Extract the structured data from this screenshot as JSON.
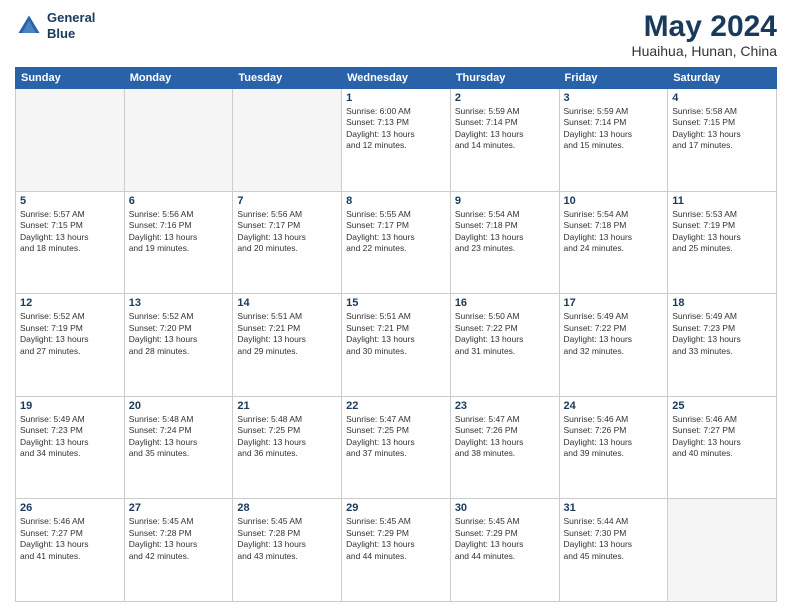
{
  "header": {
    "logo_line1": "General",
    "logo_line2": "Blue",
    "title": "May 2024",
    "subtitle": "Huaihua, Hunan, China"
  },
  "weekdays": [
    "Sunday",
    "Monday",
    "Tuesday",
    "Wednesday",
    "Thursday",
    "Friday",
    "Saturday"
  ],
  "weeks": [
    [
      {
        "day": "",
        "info": ""
      },
      {
        "day": "",
        "info": ""
      },
      {
        "day": "",
        "info": ""
      },
      {
        "day": "1",
        "info": "Sunrise: 6:00 AM\nSunset: 7:13 PM\nDaylight: 13 hours\nand 12 minutes."
      },
      {
        "day": "2",
        "info": "Sunrise: 5:59 AM\nSunset: 7:14 PM\nDaylight: 13 hours\nand 14 minutes."
      },
      {
        "day": "3",
        "info": "Sunrise: 5:59 AM\nSunset: 7:14 PM\nDaylight: 13 hours\nand 15 minutes."
      },
      {
        "day": "4",
        "info": "Sunrise: 5:58 AM\nSunset: 7:15 PM\nDaylight: 13 hours\nand 17 minutes."
      }
    ],
    [
      {
        "day": "5",
        "info": "Sunrise: 5:57 AM\nSunset: 7:15 PM\nDaylight: 13 hours\nand 18 minutes."
      },
      {
        "day": "6",
        "info": "Sunrise: 5:56 AM\nSunset: 7:16 PM\nDaylight: 13 hours\nand 19 minutes."
      },
      {
        "day": "7",
        "info": "Sunrise: 5:56 AM\nSunset: 7:17 PM\nDaylight: 13 hours\nand 20 minutes."
      },
      {
        "day": "8",
        "info": "Sunrise: 5:55 AM\nSunset: 7:17 PM\nDaylight: 13 hours\nand 22 minutes."
      },
      {
        "day": "9",
        "info": "Sunrise: 5:54 AM\nSunset: 7:18 PM\nDaylight: 13 hours\nand 23 minutes."
      },
      {
        "day": "10",
        "info": "Sunrise: 5:54 AM\nSunset: 7:18 PM\nDaylight: 13 hours\nand 24 minutes."
      },
      {
        "day": "11",
        "info": "Sunrise: 5:53 AM\nSunset: 7:19 PM\nDaylight: 13 hours\nand 25 minutes."
      }
    ],
    [
      {
        "day": "12",
        "info": "Sunrise: 5:52 AM\nSunset: 7:19 PM\nDaylight: 13 hours\nand 27 minutes."
      },
      {
        "day": "13",
        "info": "Sunrise: 5:52 AM\nSunset: 7:20 PM\nDaylight: 13 hours\nand 28 minutes."
      },
      {
        "day": "14",
        "info": "Sunrise: 5:51 AM\nSunset: 7:21 PM\nDaylight: 13 hours\nand 29 minutes."
      },
      {
        "day": "15",
        "info": "Sunrise: 5:51 AM\nSunset: 7:21 PM\nDaylight: 13 hours\nand 30 minutes."
      },
      {
        "day": "16",
        "info": "Sunrise: 5:50 AM\nSunset: 7:22 PM\nDaylight: 13 hours\nand 31 minutes."
      },
      {
        "day": "17",
        "info": "Sunrise: 5:49 AM\nSunset: 7:22 PM\nDaylight: 13 hours\nand 32 minutes."
      },
      {
        "day": "18",
        "info": "Sunrise: 5:49 AM\nSunset: 7:23 PM\nDaylight: 13 hours\nand 33 minutes."
      }
    ],
    [
      {
        "day": "19",
        "info": "Sunrise: 5:49 AM\nSunset: 7:23 PM\nDaylight: 13 hours\nand 34 minutes."
      },
      {
        "day": "20",
        "info": "Sunrise: 5:48 AM\nSunset: 7:24 PM\nDaylight: 13 hours\nand 35 minutes."
      },
      {
        "day": "21",
        "info": "Sunrise: 5:48 AM\nSunset: 7:25 PM\nDaylight: 13 hours\nand 36 minutes."
      },
      {
        "day": "22",
        "info": "Sunrise: 5:47 AM\nSunset: 7:25 PM\nDaylight: 13 hours\nand 37 minutes."
      },
      {
        "day": "23",
        "info": "Sunrise: 5:47 AM\nSunset: 7:26 PM\nDaylight: 13 hours\nand 38 minutes."
      },
      {
        "day": "24",
        "info": "Sunrise: 5:46 AM\nSunset: 7:26 PM\nDaylight: 13 hours\nand 39 minutes."
      },
      {
        "day": "25",
        "info": "Sunrise: 5:46 AM\nSunset: 7:27 PM\nDaylight: 13 hours\nand 40 minutes."
      }
    ],
    [
      {
        "day": "26",
        "info": "Sunrise: 5:46 AM\nSunset: 7:27 PM\nDaylight: 13 hours\nand 41 minutes."
      },
      {
        "day": "27",
        "info": "Sunrise: 5:45 AM\nSunset: 7:28 PM\nDaylight: 13 hours\nand 42 minutes."
      },
      {
        "day": "28",
        "info": "Sunrise: 5:45 AM\nSunset: 7:28 PM\nDaylight: 13 hours\nand 43 minutes."
      },
      {
        "day": "29",
        "info": "Sunrise: 5:45 AM\nSunset: 7:29 PM\nDaylight: 13 hours\nand 44 minutes."
      },
      {
        "day": "30",
        "info": "Sunrise: 5:45 AM\nSunset: 7:29 PM\nDaylight: 13 hours\nand 44 minutes."
      },
      {
        "day": "31",
        "info": "Sunrise: 5:44 AM\nSunset: 7:30 PM\nDaylight: 13 hours\nand 45 minutes."
      },
      {
        "day": "",
        "info": ""
      }
    ]
  ]
}
